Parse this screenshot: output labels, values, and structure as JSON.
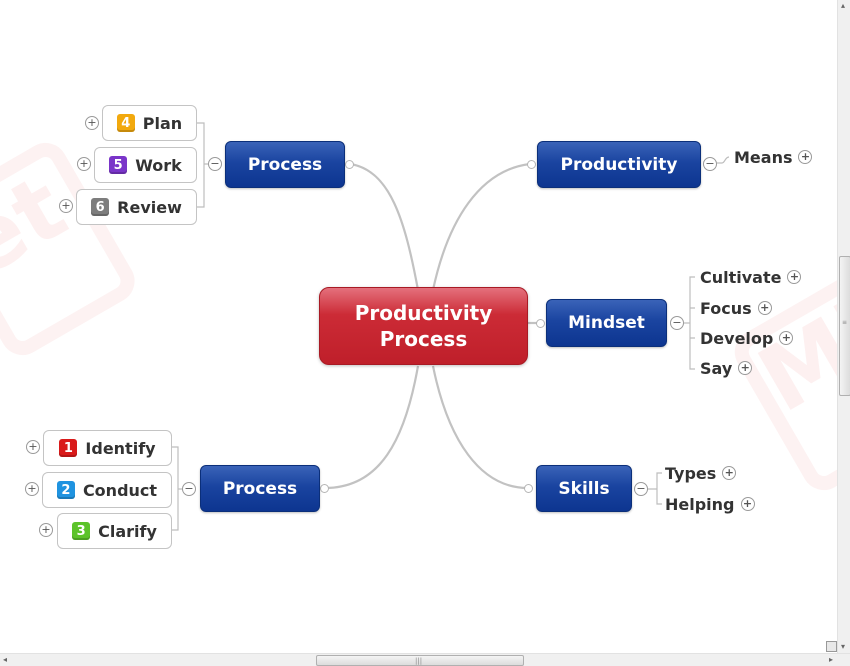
{
  "map": {
    "center": {
      "line1": "Productivity",
      "line2": "Process",
      "color": "#c4222d"
    },
    "main_node_color": "#0d3590",
    "branches": {
      "process_top": {
        "label": "Process",
        "toggle": "−",
        "children": [
          {
            "label": "Plan",
            "badge": "4",
            "badge_color": "#f2a90e",
            "toggle": "+"
          },
          {
            "label": "Work",
            "badge": "5",
            "badge_color": "#7a35c9",
            "toggle": "+"
          },
          {
            "label": "Review",
            "badge": "6",
            "badge_color": "#7d7d7d",
            "toggle": "+"
          }
        ]
      },
      "process_bottom": {
        "label": "Process",
        "toggle": "−",
        "children": [
          {
            "label": "Identify",
            "badge": "1",
            "badge_color": "#d91a1a",
            "toggle": "+"
          },
          {
            "label": "Conduct",
            "badge": "2",
            "badge_color": "#1f93e0",
            "toggle": "+"
          },
          {
            "label": "Clarify",
            "badge": "3",
            "badge_color": "#5cc32a",
            "toggle": "+"
          }
        ]
      },
      "productivity": {
        "label": "Productivity",
        "toggle": "−",
        "children": [
          {
            "label": "Means",
            "toggle": "+"
          }
        ]
      },
      "mindset": {
        "label": "Mindset",
        "toggle": "−",
        "children": [
          {
            "label": "Cultivate",
            "toggle": "+"
          },
          {
            "label": "Focus",
            "toggle": "+"
          },
          {
            "label": "Develop",
            "toggle": "+"
          },
          {
            "label": "Say",
            "toggle": "+"
          }
        ]
      },
      "skills": {
        "label": "Skills",
        "toggle": "−",
        "children": [
          {
            "label": "Types",
            "toggle": "+"
          },
          {
            "label": "Helping",
            "toggle": "+"
          }
        ]
      }
    }
  },
  "watermark": {
    "left_text": "et",
    "right_text": "Mi"
  },
  "scrollbars": {
    "grip": "|||",
    "left_arrow": "◂",
    "right_arrow": "▸",
    "up_arrow": "▴",
    "down_arrow": "▾"
  }
}
